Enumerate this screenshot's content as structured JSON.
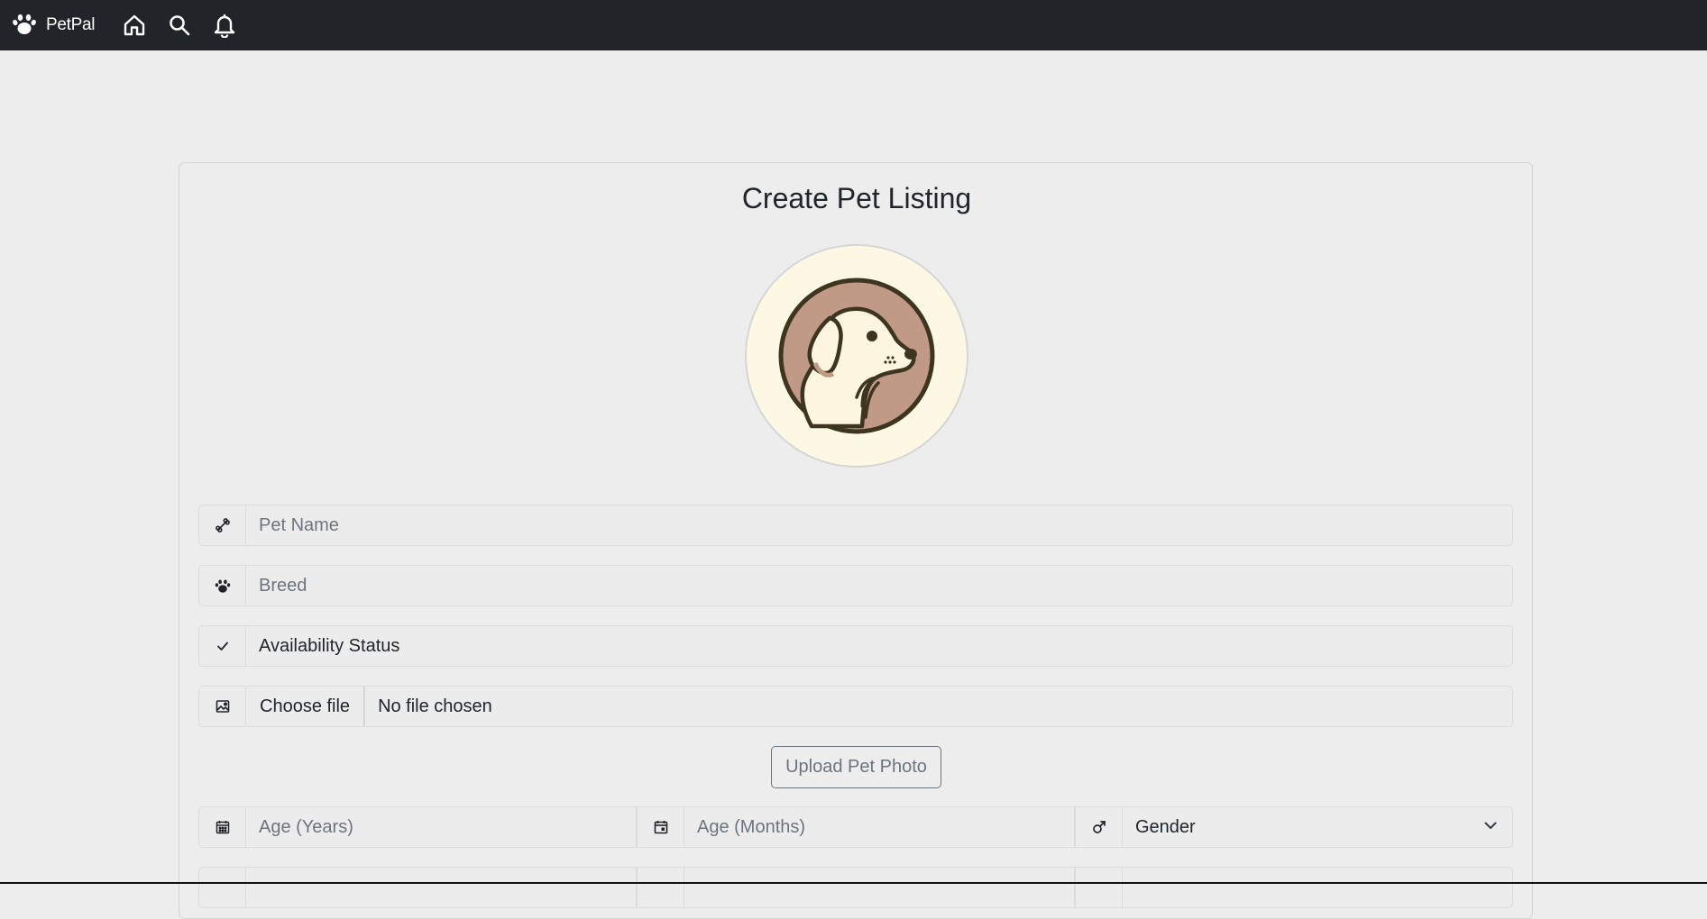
{
  "navbar": {
    "brand": "PetPal",
    "icons": [
      "paw-icon",
      "home-icon",
      "search-icon",
      "bell-icon"
    ],
    "background": "#212529"
  },
  "form": {
    "title": "Create Pet Listing",
    "pet_name_placeholder": "Pet Name",
    "breed_placeholder": "Breed",
    "availability_value": "Availability Status",
    "file_button": "Choose file",
    "file_status": "No file chosen",
    "upload_button": "Upload Pet Photo",
    "age_years_placeholder": "Age (Years)",
    "age_months_placeholder": "Age (Months)",
    "gender_value": "Gender"
  },
  "colors": {
    "page_bg": "#ededed",
    "field_bg": "#ececec",
    "placeholder": "#6c757d",
    "avatar_bg": "#fdf8e3",
    "avatar_brown": "#c09a86",
    "avatar_outline": "#3d3520"
  }
}
